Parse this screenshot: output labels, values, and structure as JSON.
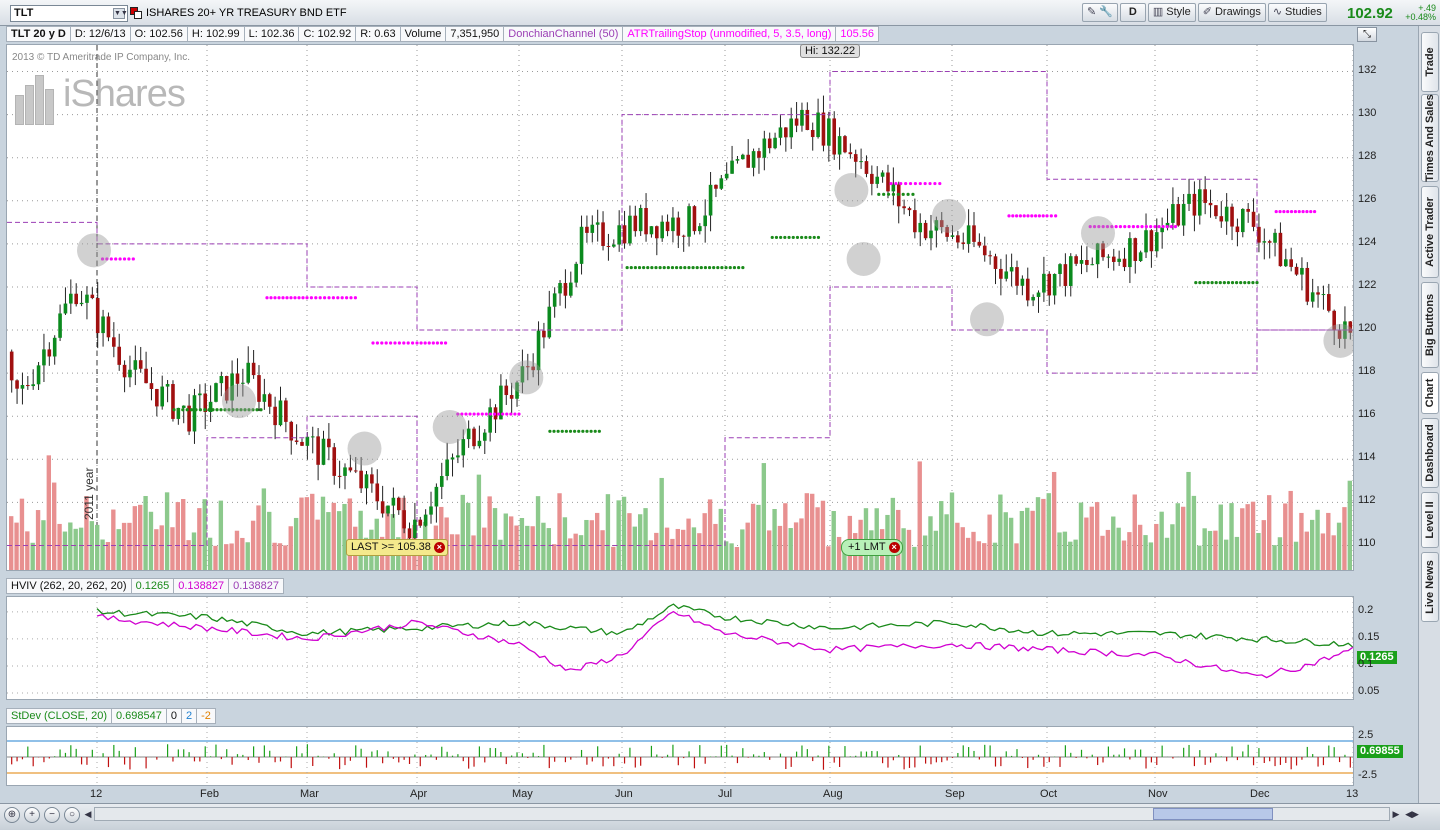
{
  "toolbar": {
    "symbol": "TLT",
    "description": "ISHARES 20+ YR TREASURY BND ETF",
    "aggregation": "D",
    "style_label": "Style",
    "drawings_label": "Drawings",
    "studies_label": "Studies",
    "last_price": "102.92",
    "net_change": "+.49",
    "pct_change": "+0.48%"
  },
  "info": {
    "series": "TLT 20 y D",
    "date": "D: 12/6/13",
    "open": "O: 102.56",
    "high": "H: 102.99",
    "low": "L: 102.36",
    "close": "C: 102.92",
    "range": "R: 0.63",
    "volume_label": "Volume",
    "volume": "7,351,950",
    "donchian": "DonchianChannel (50)",
    "atr_stop": "ATRTrailingStop (unmodified, 5, 3.5, long)",
    "atr_value": "105.56"
  },
  "chart": {
    "copyright": "2013 © TD Ameritrade IP Company, Inc.",
    "logo_text": "iShares",
    "hi_label": "Hi: 132.22",
    "year_label": "2011 year",
    "alert_label": "LAST >= 105.38",
    "order_label": "+1 LMT",
    "y_ticks": [
      "132",
      "130",
      "128",
      "126",
      "124",
      "122",
      "120",
      "118",
      "116",
      "114",
      "112",
      "110"
    ],
    "x_labels": [
      "12",
      "Feb",
      "Mar",
      "Apr",
      "May",
      "Jun",
      "Jul",
      "Aug",
      "Sep",
      "Oct",
      "Nov",
      "Dec",
      "13"
    ],
    "colors": {
      "up": "#0b8a1e",
      "down": "#a01010",
      "vol_up": "#8cc98c",
      "vol_down": "#e89090",
      "donchian": "#9b3fb5",
      "atr": "#ff00ff",
      "stop_green": "#1a8a1a"
    }
  },
  "hviv": {
    "label": "HVIV (262, 20, 262, 20)",
    "v1": "0.1265",
    "v2": "0.138827",
    "v3": "0.138827",
    "badge": "0.1265",
    "y_ticks": [
      "0.2",
      "0.15",
      "0.1",
      "0.05"
    ]
  },
  "stdev": {
    "label": "StDev (CLOSE, 20)",
    "v1": "0.698547",
    "v2": "0",
    "v3": "2",
    "v4": "-2",
    "badge": "0.69855",
    "y_ticks": [
      "2.5",
      "-2.5"
    ]
  },
  "sidebar": {
    "tabs": [
      "Trade",
      "Times And Sales",
      "Active Trader",
      "Big Buttons",
      "Chart",
      "Dashboard",
      "Level II",
      "Live News"
    ]
  },
  "chart_data": {
    "type": "candlestick",
    "symbol": "TLT",
    "title": "ISHARES 20+ YR TREASURY BND ETF",
    "ylim": [
      109,
      133
    ],
    "y_ticks": [
      110,
      112,
      114,
      116,
      118,
      120,
      122,
      124,
      126,
      128,
      130,
      132
    ],
    "x_labels": [
      "12",
      "Feb",
      "Mar",
      "Apr",
      "May",
      "Jun",
      "Jul",
      "Aug",
      "Sep",
      "Oct",
      "Nov",
      "Dec",
      "13"
    ],
    "series": [
      {
        "name": "close",
        "type": "candles",
        "x_months": [
          0.0,
          0.5,
          1.0,
          1.5,
          2.0,
          2.5,
          3.0,
          3.5,
          4.0,
          4.5,
          5.0,
          5.5,
          6.0,
          6.5,
          7.0,
          7.5,
          8.0,
          8.5,
          9.0,
          9.5,
          10.0,
          10.5,
          11.0,
          11.5,
          12.0
        ],
        "values": [
          117,
          122,
          118,
          116,
          118,
          115,
          113,
          111,
          115,
          118,
          124,
          125,
          125,
          128,
          130,
          128,
          125,
          124,
          122,
          123,
          124,
          126,
          125,
          122,
          119
        ]
      },
      {
        "name": "DonchianChannel (50)",
        "upper": [
          125,
          124,
          124,
          122,
          120,
          120,
          130,
          130,
          132,
          132,
          127,
          127,
          120
        ],
        "lower": [
          110,
          110,
          115,
          116,
          110,
          110,
          110,
          115,
          122,
          120,
          118,
          118,
          120
        ]
      }
    ],
    "hi": 132.22,
    "last": 102.92
  }
}
